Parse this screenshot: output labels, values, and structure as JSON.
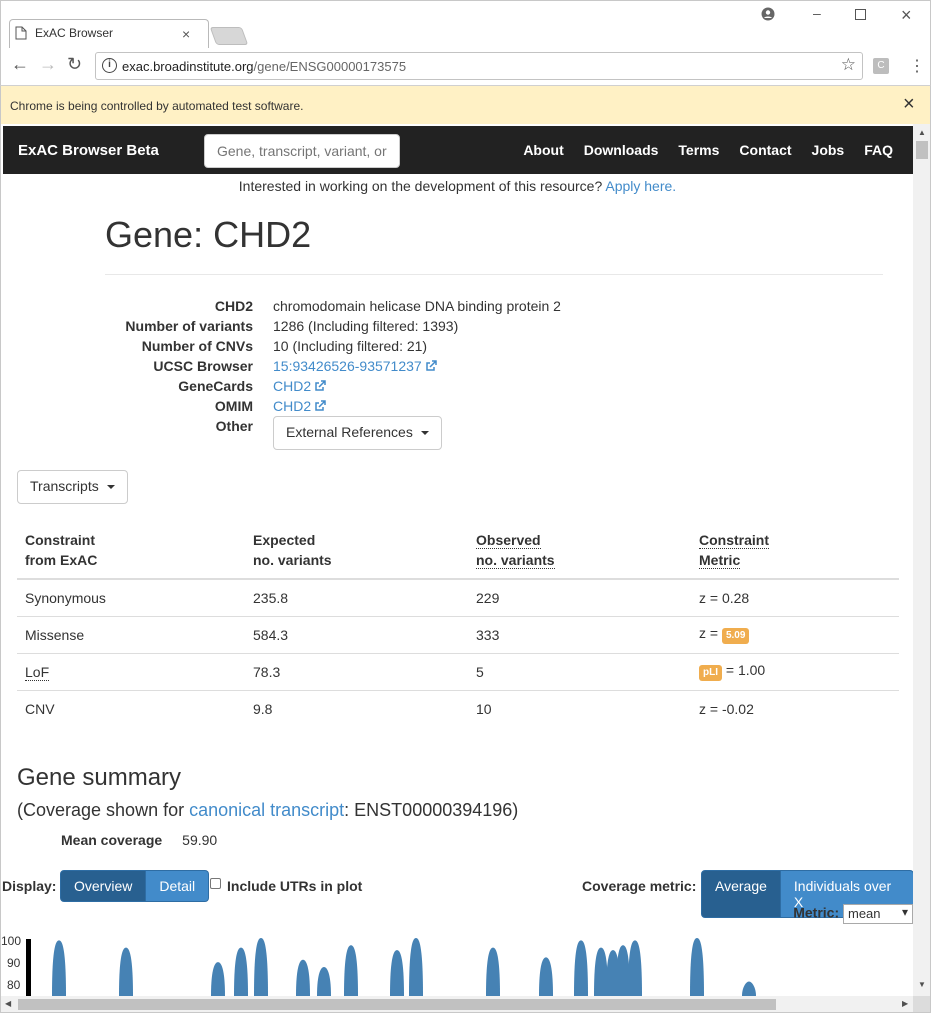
{
  "browser": {
    "tab_title": "ExAC Browser",
    "url_host": "exac.broadinstitute.org",
    "url_path": "/gene/ENSG00000173575",
    "infobar_text": "Chrome is being controlled by automated test software."
  },
  "navbar": {
    "brand": "ExAC Browser Beta",
    "search_placeholder": "Gene, transcript, variant, or",
    "links": [
      "About",
      "Downloads",
      "Terms",
      "Contact",
      "Jobs",
      "FAQ"
    ]
  },
  "banner": {
    "text": "Interested in working on the development of this resource?",
    "link": "Apply here."
  },
  "gene": {
    "title": "Gene: CHD2",
    "info": [
      {
        "label": "CHD2",
        "value": "chromodomain helicase DNA binding protein 2"
      },
      {
        "label": "Number of variants",
        "value": "1286 (Including filtered: 1393)"
      },
      {
        "label": "Number of CNVs",
        "value": "10 (Including filtered: 21)"
      },
      {
        "label": "UCSC Browser",
        "value": "15:93426526-93571237"
      },
      {
        "label": "GeneCards",
        "value": "CHD2"
      },
      {
        "label": "OMIM",
        "value": "CHD2"
      },
      {
        "label": "Other",
        "value": "External References"
      }
    ],
    "transcripts_button": "Transcripts"
  },
  "constraint": {
    "headers": [
      [
        "Constraint",
        "from ExAC"
      ],
      [
        "Expected",
        "no. variants"
      ],
      [
        "Observed",
        "no. variants"
      ],
      [
        "Constraint",
        "Metric"
      ]
    ],
    "rows": [
      {
        "category": "Synonymous",
        "expected": "235.8",
        "observed": "229",
        "metric_prefix": "z = 0.28",
        "badge": "",
        "metric_suffix": ""
      },
      {
        "category": "Missense",
        "expected": "584.3",
        "observed": "333",
        "metric_prefix": "z = ",
        "badge": "5.09",
        "metric_suffix": ""
      },
      {
        "category": "LoF",
        "expected": "78.3",
        "observed": "5",
        "metric_prefix": "",
        "badge": "pLI",
        "metric_suffix": " = 1.00"
      },
      {
        "category": "CNV",
        "expected": "9.8",
        "observed": "10",
        "metric_prefix": "z = -0.02",
        "badge": "",
        "metric_suffix": ""
      }
    ]
  },
  "summary": {
    "heading": "Gene summary",
    "sub_prefix": "(Coverage shown for ",
    "sub_link": "canonical transcript",
    "sub_suffix": ": ENST00000394196)",
    "mean_coverage_label": "Mean coverage",
    "mean_coverage_value": "59.90"
  },
  "controls": {
    "display_label": "Display:",
    "overview": "Overview",
    "detail": "Detail",
    "include_utrs": "Include UTRs in plot",
    "coverage_metric_label": "Coverage metric:",
    "average": "Average",
    "individuals": "Individuals over X",
    "metric_label": "Metric:",
    "metric_value": "mean"
  },
  "chart_data": {
    "type": "area",
    "y_tick_labels": [
      "100",
      "90",
      "80"
    ],
    "ylim": [
      80,
      100
    ],
    "peaks_x": [
      58,
      125,
      217,
      240,
      260,
      302,
      323,
      350,
      396,
      415,
      492,
      545,
      580,
      600,
      612,
      622,
      634,
      696,
      748
    ],
    "peaks_y": [
      99,
      96,
      90,
      96,
      100,
      91,
      88,
      97,
      95,
      100,
      96,
      92,
      99,
      96,
      95,
      97,
      99,
      100,
      82
    ]
  },
  "colors": {
    "navbar": "#222222",
    "link": "#428bca",
    "badge": "#f0ad4e",
    "btn_active": "#286090",
    "btn_primary": "#428bca",
    "coverage": "#4682b4",
    "infobar": "#fff1c5"
  }
}
